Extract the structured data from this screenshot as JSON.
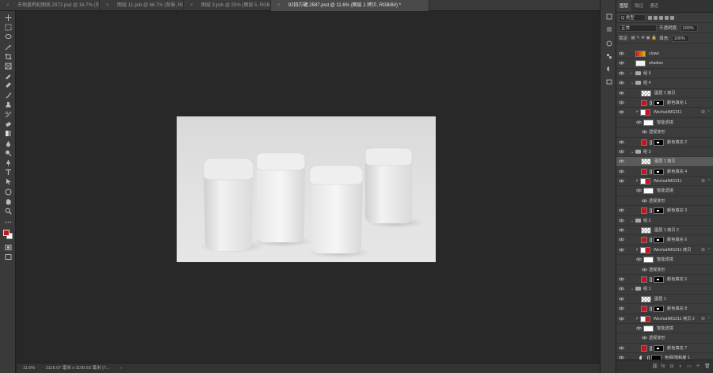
{
  "tabs": [
    {
      "label": "天地盖枸杞图底.2972.psd @ 16.7% (内盒, RGB/8#) *",
      "active": false
    },
    {
      "label": "图层 11.psb @ 66.7% (背景, RGB/8) *",
      "active": false
    },
    {
      "label": "图层 3.psb @ 25% (图层 5, RGB/8)",
      "active": false
    },
    {
      "label": "92四方罐.2587.psd @ 11.6% (图层 1 拷贝, RGB/8#) *",
      "active": true
    }
  ],
  "tab_close_glyph": "×",
  "status": {
    "zoom": "11.6%",
    "doc_size": "2116.67 毫米 x 1190.63 毫米 (7...",
    "arrow": "›"
  },
  "panel": {
    "tabs": [
      "图层",
      "路径",
      "通道"
    ],
    "filter_kind": "Q 类型",
    "blend_mode": "正常",
    "opacity_label": "不透明度:",
    "opacity_value": "100%",
    "lock_label": "锁定:",
    "fill_label": "填充:",
    "fill_value": "100%"
  },
  "layers": [
    {
      "name": "clown",
      "kind": "thumb",
      "indent": 0,
      "thumb": "red-yellow"
    },
    {
      "name": "shadow",
      "kind": "thumb",
      "indent": 0,
      "thumb": "white"
    },
    {
      "name": "组 5",
      "kind": "group",
      "indent": 0,
      "collapsed": true
    },
    {
      "name": "组 4",
      "kind": "group",
      "indent": 0,
      "collapsed": false
    },
    {
      "name": "图层 1 拷贝",
      "kind": "thumb",
      "indent": 1,
      "thumb": "checker"
    },
    {
      "name": "颜色填充 1",
      "kind": "fill",
      "indent": 1
    },
    {
      "name": "WechatIMG311",
      "kind": "smart",
      "indent": 1
    },
    {
      "name": "智能滤镜",
      "kind": "filter",
      "indent": 2
    },
    {
      "name": "透视变形",
      "kind": "sub",
      "indent": 3
    },
    {
      "name": "颜色填充 2",
      "kind": "fill",
      "indent": 1
    },
    {
      "name": "组 3",
      "kind": "group",
      "indent": 0,
      "collapsed": false
    },
    {
      "name": "图层 1 拷贝",
      "kind": "thumb",
      "indent": 1,
      "thumb": "checker",
      "selected": true
    },
    {
      "name": "颜色填充 4",
      "kind": "fill",
      "indent": 1
    },
    {
      "name": "WechatIMG311",
      "kind": "smart",
      "indent": 1
    },
    {
      "name": "智能滤镜",
      "kind": "filter",
      "indent": 2
    },
    {
      "name": "透视变形",
      "kind": "sub",
      "indent": 3
    },
    {
      "name": "颜色填充 3",
      "kind": "fill",
      "indent": 1
    },
    {
      "name": "组 2",
      "kind": "group",
      "indent": 0,
      "collapsed": false
    },
    {
      "name": "图层 1 拷贝 2",
      "kind": "thumb",
      "indent": 1,
      "thumb": "checker"
    },
    {
      "name": "颜色填充 6",
      "kind": "fill",
      "indent": 1
    },
    {
      "name": "WechatIMG311 拷贝",
      "kind": "smart",
      "indent": 1
    },
    {
      "name": "智能滤镜",
      "kind": "filter",
      "indent": 2
    },
    {
      "name": "透视变形",
      "kind": "sub",
      "indent": 3
    },
    {
      "name": "颜色填充 5",
      "kind": "fill",
      "indent": 1
    },
    {
      "name": "组 1",
      "kind": "group",
      "indent": 0,
      "collapsed": false
    },
    {
      "name": "图层 1",
      "kind": "thumb",
      "indent": 1,
      "thumb": "checker"
    },
    {
      "name": "颜色填充 8",
      "kind": "fill",
      "indent": 1
    },
    {
      "name": "WechatIMG311 拷贝 2",
      "kind": "smart",
      "indent": 1
    },
    {
      "name": "智能滤镜",
      "kind": "filter",
      "indent": 2
    },
    {
      "name": "透视变形",
      "kind": "sub",
      "indent": 3
    },
    {
      "name": "颜色填充 7",
      "kind": "fill",
      "indent": 1
    },
    {
      "name": "色相/饱和度 1",
      "kind": "adjust",
      "indent": 0
    },
    {
      "name": "rgb",
      "kind": "thumb",
      "indent": 0,
      "thumb": "gray"
    }
  ],
  "footer_icons": [
    "link-icon",
    "fx-icon",
    "mask-icon",
    "adjustment-icon",
    "group-icon",
    "new-layer-icon",
    "trash-icon"
  ],
  "footer_glyphs": [
    "⛓",
    "fx",
    "◘",
    "◐",
    "▭",
    "＋",
    "🗑"
  ],
  "colors": {
    "foreground": "#c8141e",
    "background": "#ffffff",
    "fill_swatch": "#c8141e"
  }
}
